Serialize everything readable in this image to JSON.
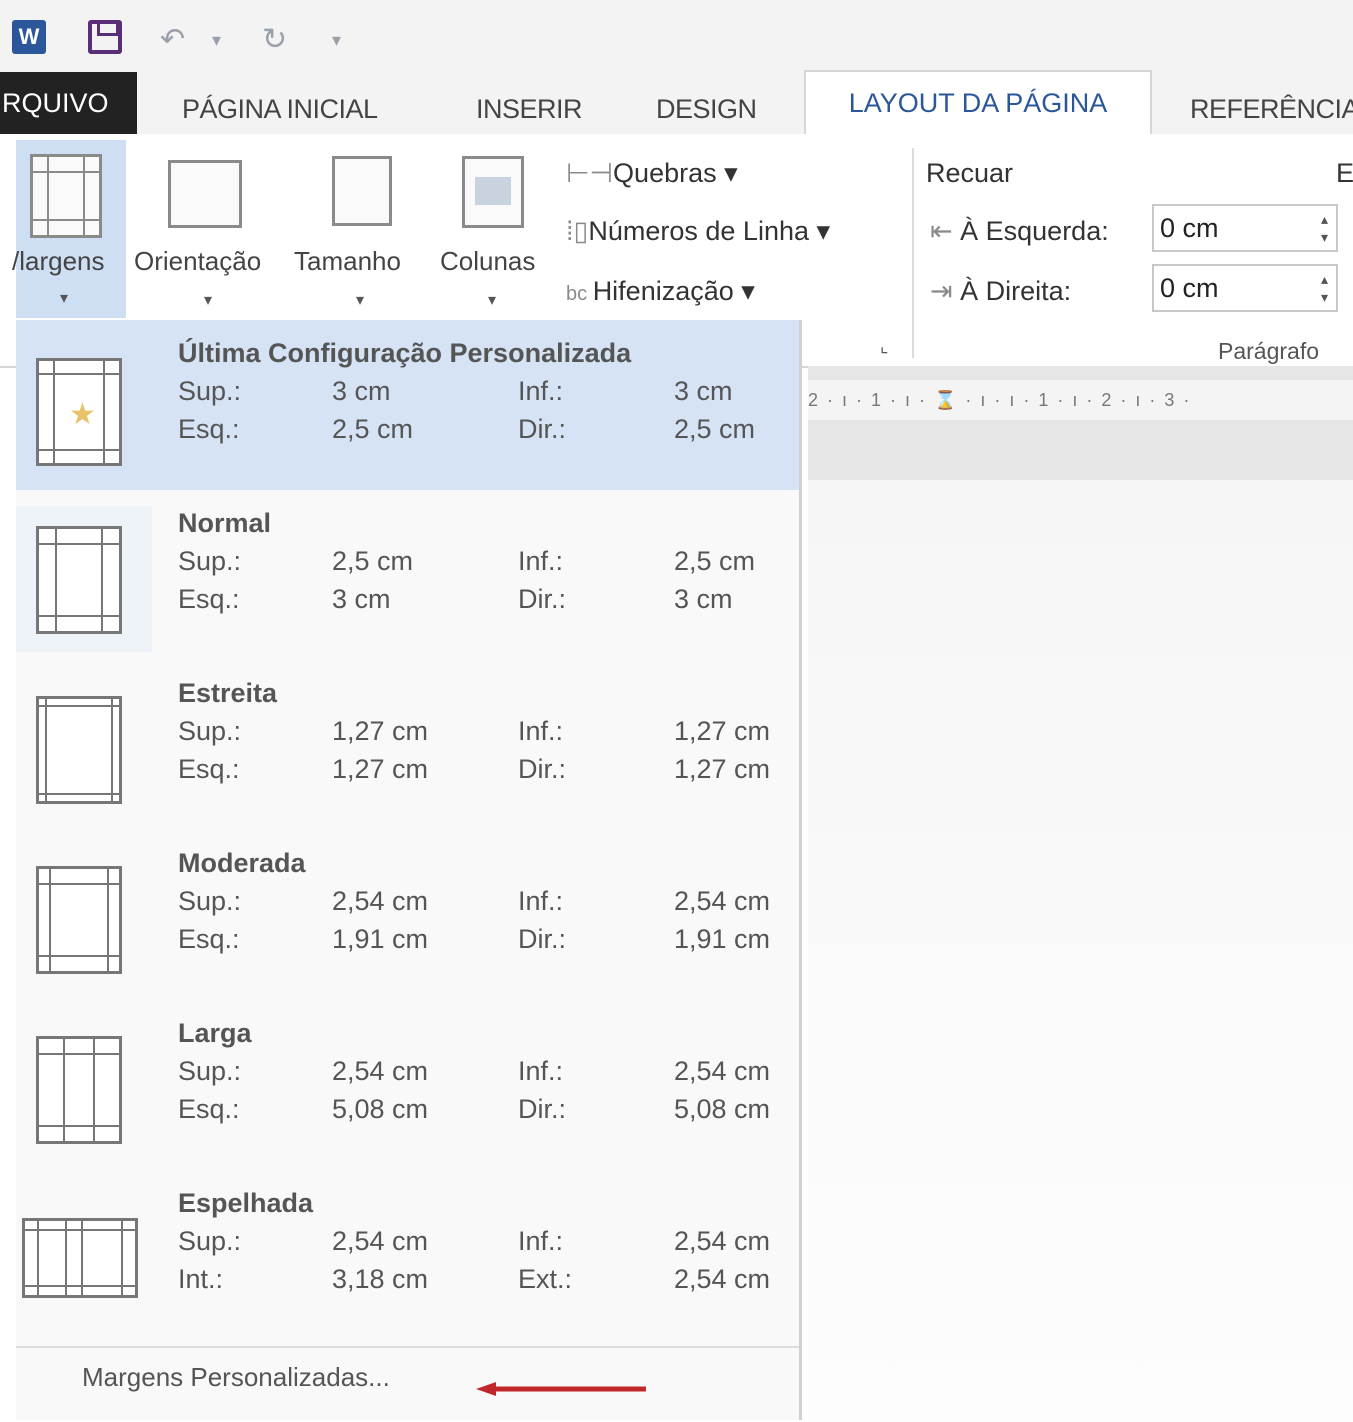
{
  "qat": {
    "word_icon": "W",
    "save_icon": "save-icon",
    "undo": "↶",
    "undo_caret": "▾",
    "redo": "↻",
    "customize": "▾"
  },
  "tabs": {
    "arquivo": "RQUIVO",
    "inicial": "PÁGINA INICIAL",
    "inserir": "INSERIR",
    "design": "DESIGN",
    "layout": "LAYOUT DA PÁGINA",
    "referencias": "REFERÊNCIA"
  },
  "ribbon": {
    "margens": "/largens",
    "orientacao": "Orientação",
    "tamanho": "Tamanho",
    "colunas": "Colunas",
    "quebras": "Quebras ▾",
    "numeros_linha": "Números de Linha ▾",
    "hifenizacao": "Hifenização ▾",
    "recuar": "Recuar",
    "espacamento_cut": "E",
    "esquerda_label": "À Esquerda:",
    "direita_label": "À Direita:",
    "esquerda_value": "0 cm",
    "direita_value": "0 cm",
    "paragrafo": "Parágrafo",
    "dialog_launcher": "⌞"
  },
  "ruler": {
    "ticks": "2 · ı · 1 · ı · ⌛ · ı · ı · 1 · ı · 2 · ı · 3 ·"
  },
  "dropdown": {
    "items": [
      {
        "title": "Última Configuração Personalizada",
        "l1": "Sup.:",
        "v1": "3 cm",
        "l2": "Inf.:",
        "v2": "3 cm",
        "l3": "Esq.:",
        "v3": "2,5 cm",
        "l4": "Dir.:",
        "v4": "2,5 cm"
      },
      {
        "title": "Normal",
        "l1": "Sup.:",
        "v1": "2,5 cm",
        "l2": "Inf.:",
        "v2": "2,5 cm",
        "l3": "Esq.:",
        "v3": "3 cm",
        "l4": "Dir.:",
        "v4": "3 cm"
      },
      {
        "title": "Estreita",
        "l1": "Sup.:",
        "v1": "1,27 cm",
        "l2": "Inf.:",
        "v2": "1,27 cm",
        "l3": "Esq.:",
        "v3": "1,27 cm",
        "l4": "Dir.:",
        "v4": "1,27 cm"
      },
      {
        "title": "Moderada",
        "l1": "Sup.:",
        "v1": "2,54 cm",
        "l2": "Inf.:",
        "v2": "2,54 cm",
        "l3": "Esq.:",
        "v3": "1,91 cm",
        "l4": "Dir.:",
        "v4": "1,91 cm"
      },
      {
        "title": "Larga",
        "l1": "Sup.:",
        "v1": "2,54 cm",
        "l2": "Inf.:",
        "v2": "2,54 cm",
        "l3": "Esq.:",
        "v3": "5,08 cm",
        "l4": "Dir.:",
        "v4": "5,08 cm"
      },
      {
        "title": "Espelhada",
        "l1": "Sup.:",
        "v1": "2,54 cm",
        "l2": "Inf.:",
        "v2": "2,54 cm",
        "l3": "Int.:",
        "v3": "3,18 cm",
        "l4": "Ext.:",
        "v4": "2,54 cm"
      }
    ],
    "custom": "Margens Personalizadas..."
  },
  "colors": {
    "accent": "#2b579a",
    "selected_bg": "#d6e3f4",
    "arrow": "#c0282b"
  }
}
